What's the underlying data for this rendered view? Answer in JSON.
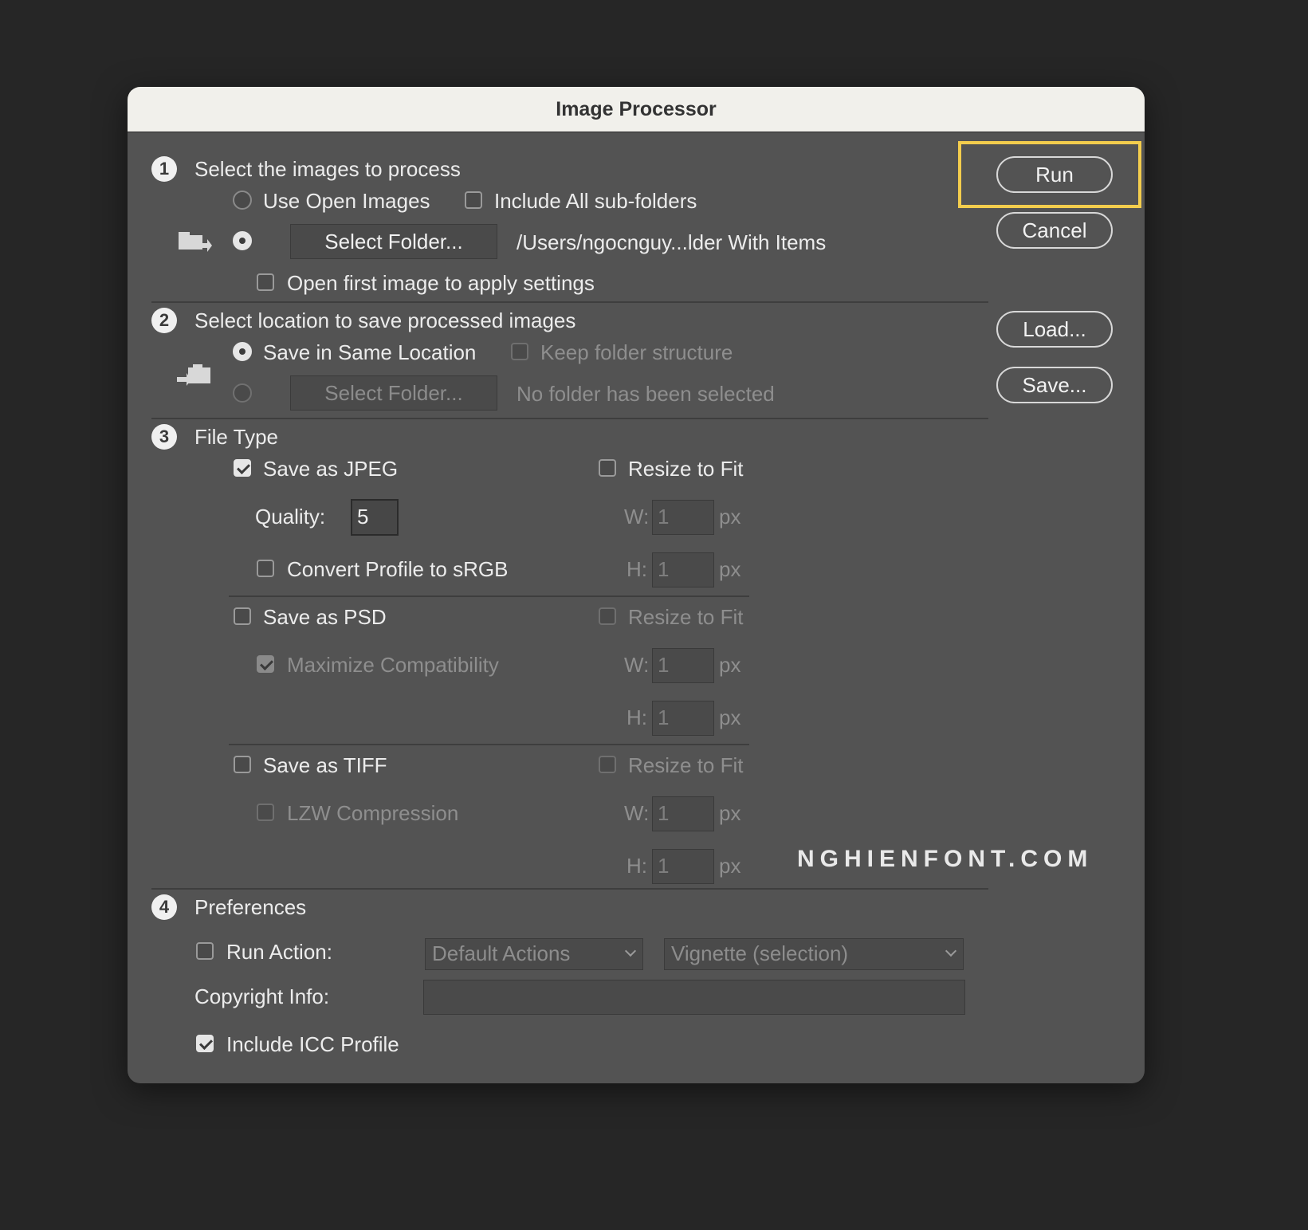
{
  "dialog": {
    "title": "Image Processor"
  },
  "section1": {
    "number": "1",
    "heading": "Select the images to process",
    "use_open_images": "Use Open Images",
    "include_subfolders": "Include All sub-folders",
    "select_folder": "Select Folder...",
    "folder_path": "/Users/ngocnguy...lder With Items",
    "open_first_image": "Open first image to apply settings"
  },
  "section2": {
    "number": "2",
    "heading": "Select location to save processed images",
    "save_same_location": "Save in Same Location",
    "keep_folder_structure": "Keep folder structure",
    "select_folder": "Select Folder...",
    "no_folder": "No folder has been selected"
  },
  "section3": {
    "number": "3",
    "heading": "File Type",
    "jpeg": {
      "label": "Save as JPEG",
      "resize": "Resize to Fit",
      "quality_label": "Quality:",
      "quality_value": "5",
      "convert_profile": "Convert Profile to sRGB",
      "w_label": "W:",
      "w_value": "1",
      "h_label": "H:",
      "h_value": "1",
      "unit": "px"
    },
    "psd": {
      "label": "Save as PSD",
      "resize": "Resize to Fit",
      "maximize": "Maximize Compatibility",
      "w_label": "W:",
      "w_value": "1",
      "h_label": "H:",
      "h_value": "1",
      "unit": "px"
    },
    "tiff": {
      "label": "Save as TIFF",
      "resize": "Resize to Fit",
      "lzw": "LZW Compression",
      "w_label": "W:",
      "w_value": "1",
      "h_label": "H:",
      "h_value": "1",
      "unit": "px"
    }
  },
  "section4": {
    "number": "4",
    "heading": "Preferences",
    "run_action": "Run Action:",
    "action_set": "Default Actions",
    "action": "Vignette (selection)",
    "copyright_label": "Copyright Info:",
    "copyright_value": "",
    "include_icc": "Include ICC Profile"
  },
  "buttons": {
    "run": "Run",
    "cancel": "Cancel",
    "load": "Load...",
    "save": "Save..."
  },
  "watermark": "NGHIENFONT.COM",
  "colors": {
    "dialog_bg": "#535353",
    "highlight": "#f3cd4d",
    "titlebar": "#f1f0eb"
  }
}
